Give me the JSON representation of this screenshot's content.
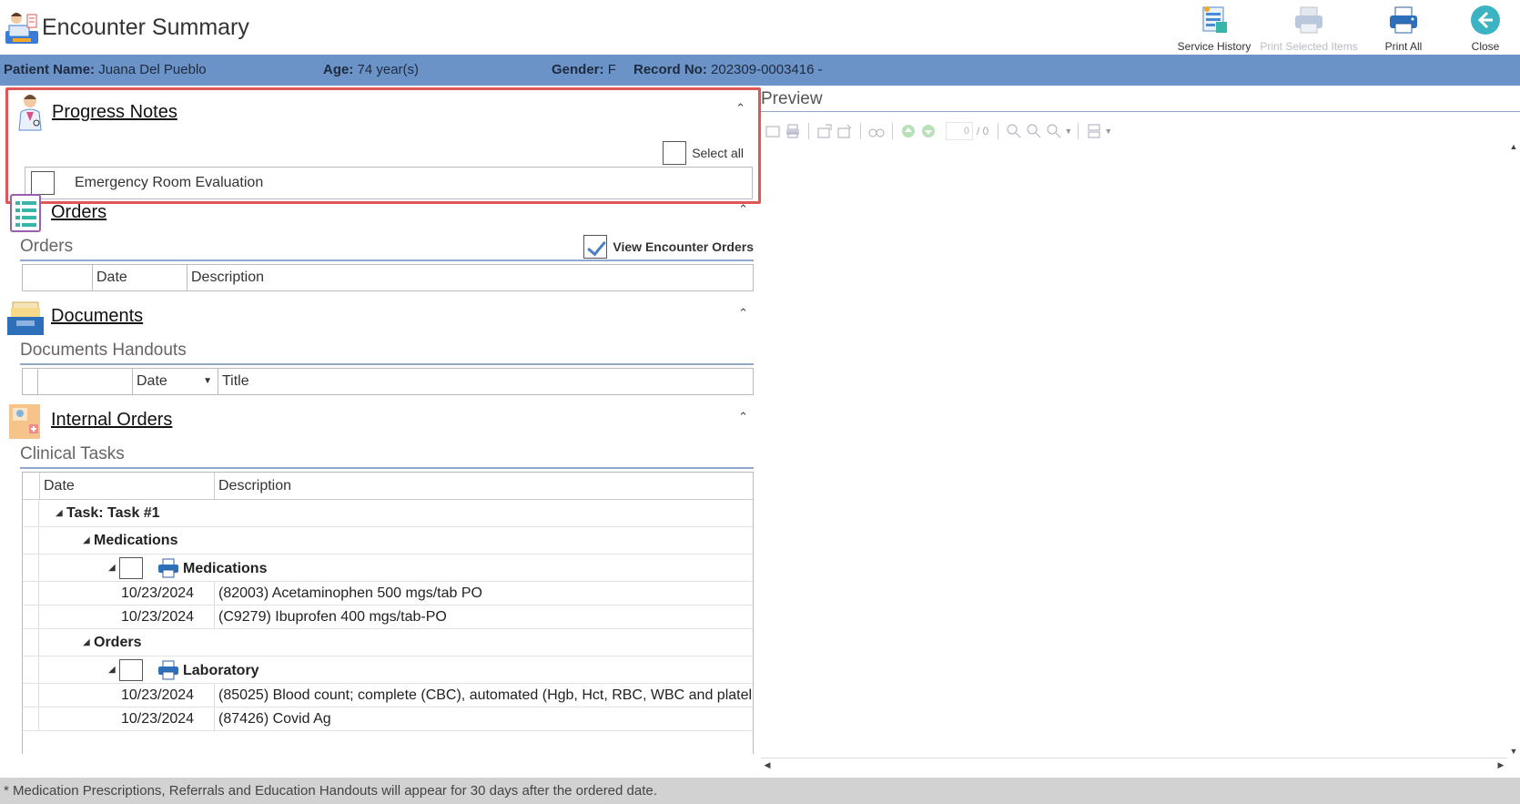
{
  "header": {
    "title": "Encounter Summary",
    "toolbar": [
      {
        "label": "Service History",
        "icon": "service-history-icon",
        "enabled": true
      },
      {
        "label": "Print Selected Items",
        "icon": "print-selected-icon",
        "enabled": false
      },
      {
        "label": "Print All",
        "icon": "printer-icon",
        "enabled": true
      },
      {
        "label": "Close",
        "icon": "back-arrow-icon",
        "enabled": true
      }
    ]
  },
  "patient": {
    "name_label": "Patient Name:",
    "name": "Juana Del Pueblo",
    "age_label": "Age:",
    "age": "74 year(s)",
    "gender_label": "Gender:",
    "gender": "F",
    "record_label": "Record No:",
    "record": "202309-0003416 -"
  },
  "progress_notes": {
    "title": "Progress Notes",
    "select_all": "Select all",
    "items": [
      "Emergency Room Evaluation"
    ]
  },
  "orders": {
    "title": "Orders",
    "subtitle": "Orders",
    "view_encounter_orders": "View Encounter Orders",
    "columns": [
      "Date",
      "Description"
    ]
  },
  "documents": {
    "title": "Documents",
    "subtitle": "Documents Handouts",
    "columns": [
      "Date",
      "Title"
    ]
  },
  "internal_orders": {
    "title": "Internal Orders",
    "subtitle": "Clinical Tasks",
    "columns": [
      "Date",
      "Description"
    ],
    "task_label": "Task: Task #1",
    "group_medications": "Medications",
    "medications_node": "Medications",
    "medication_rows": [
      {
        "date": "10/23/2024",
        "desc": "(82003) Acetaminophen 500 mgs/tab PO"
      },
      {
        "date": "10/23/2024",
        "desc": "(C9279) Ibuprofen 400 mgs/tab-PO"
      }
    ],
    "group_orders": "Orders",
    "laboratory_node": "Laboratory",
    "lab_rows": [
      {
        "date": "10/23/2024",
        "desc": "(85025) Blood count; complete (CBC), automated (Hgb, Hct, RBC, WBC and platel..."
      },
      {
        "date": "10/23/2024",
        "desc": "(87426) Covid Ag"
      }
    ]
  },
  "preview": {
    "title": "Preview",
    "page_value": "0",
    "page_total": "/ 0"
  },
  "footer": {
    "note": "* Medication Prescriptions, Referrals and Education Handouts will appear for 30 days after the ordered date."
  }
}
